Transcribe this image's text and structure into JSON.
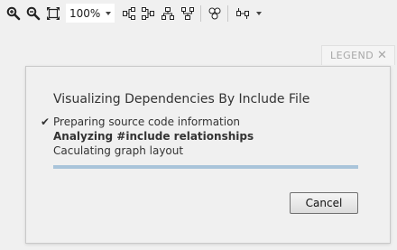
{
  "toolbar": {
    "zoom_value": "100%",
    "icons": [
      "zoom-in-icon",
      "zoom-out-icon",
      "fit-to-window-icon",
      "layout-left-right-icon",
      "layout-right-left-icon",
      "layout-top-down-icon",
      "layout-bottom-up-icon",
      "cluster-icon",
      "layout-options-icon"
    ]
  },
  "legend": {
    "label": "LEGEND",
    "close_glyph": "✕"
  },
  "dialog": {
    "title": "Visualizing Dependencies By Include File",
    "check_glyph": "✔",
    "steps": [
      {
        "label": "Preparing source code information",
        "status": "done"
      },
      {
        "label": "Analyzing #include relationships",
        "status": "active"
      },
      {
        "label": "Caculating graph layout",
        "status": "pending"
      }
    ],
    "progress": 1.0,
    "cancel_label": "Cancel"
  },
  "colors": {
    "progress": "#a9c4da",
    "background": "#f0f0f0"
  }
}
